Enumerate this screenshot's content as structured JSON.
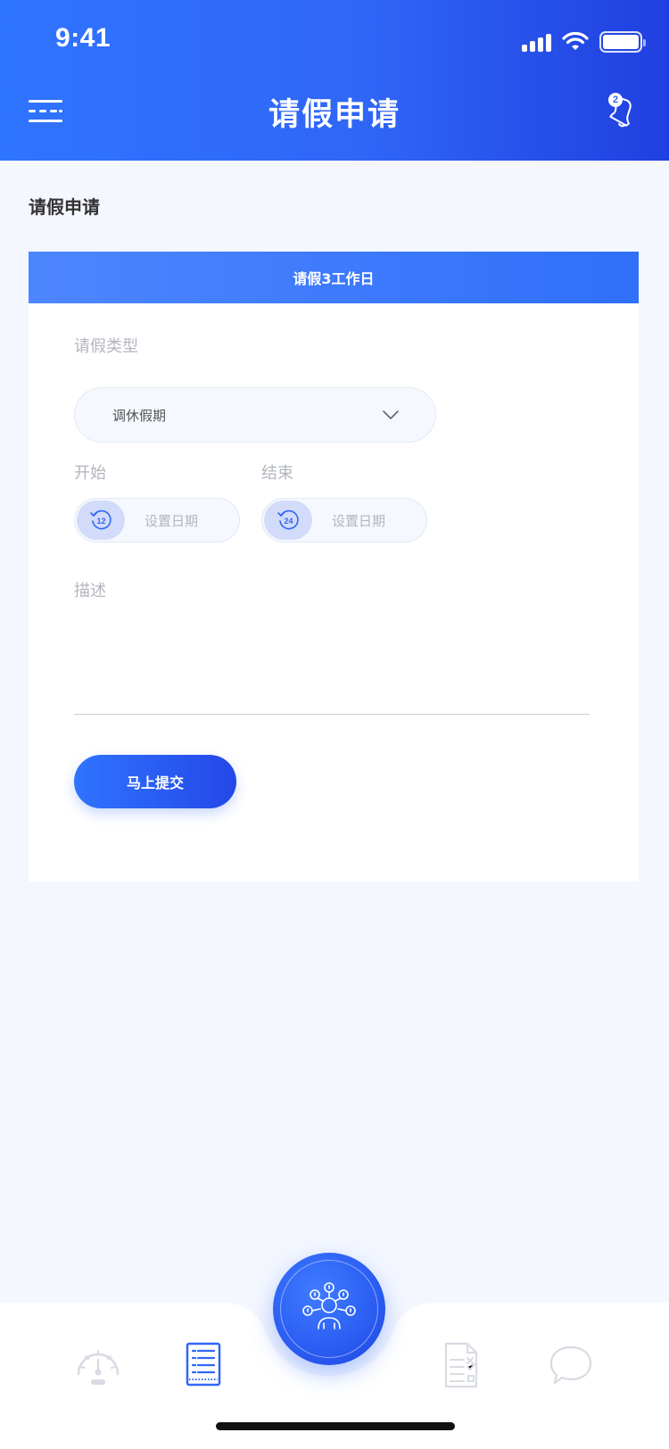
{
  "status_bar": {
    "time": "9:41"
  },
  "header": {
    "title": "请假申请",
    "notification_count": "2"
  },
  "page": {
    "title": "请假申请"
  },
  "form": {
    "banner": "请假3工作日",
    "leave_type_label": "请假类型",
    "leave_type_value": "调休假期",
    "start_label": "开始",
    "start_day": "12",
    "start_placeholder": "设置日期",
    "end_label": "结束",
    "end_day": "24",
    "end_placeholder": "设置日期",
    "description_label": "描述",
    "submit_label": "马上提交"
  },
  "tabbar": {
    "tabs": [
      {
        "icon": "speedometer-icon",
        "active": false
      },
      {
        "icon": "form-list-icon",
        "active": true
      },
      {
        "icon": "center-action-icon",
        "active": false
      },
      {
        "icon": "checklist-document-icon",
        "active": false
      },
      {
        "icon": "chat-bubble-icon",
        "active": false
      }
    ]
  },
  "colors": {
    "primary": "#2f66f6",
    "primary_dark": "#2040e0",
    "background": "#f4f7fe",
    "muted_text": "#b3b6be"
  }
}
